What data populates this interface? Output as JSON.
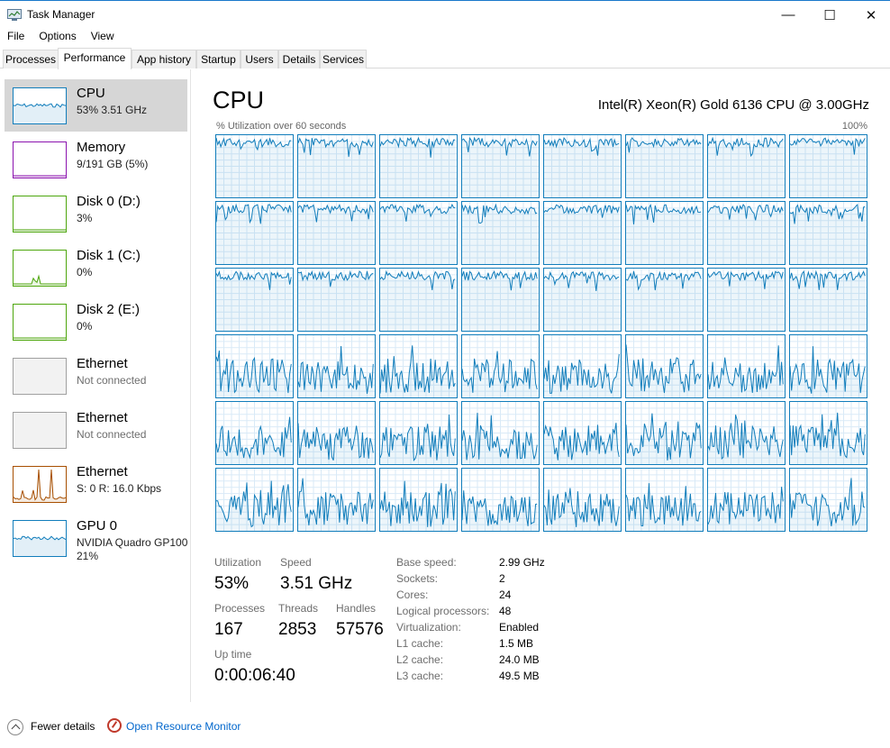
{
  "window": {
    "title": "Task Manager",
    "minimize": "—",
    "maximize": "☐",
    "close": "✕"
  },
  "menu": [
    "File",
    "Options",
    "View"
  ],
  "tabs": [
    "Processes",
    "Performance",
    "App history",
    "Startup",
    "Users",
    "Details",
    "Services"
  ],
  "active_tab": "Performance",
  "sidebar": [
    {
      "name": "CPU",
      "sub": "53%  3.51 GHz",
      "color": "#117dbb",
      "selected": true,
      "kind": "cpu"
    },
    {
      "name": "Memory",
      "sub": "9/191 GB (5%)",
      "color": "#8b12ae",
      "kind": "flat"
    },
    {
      "name": "Disk 0 (D:)",
      "sub": "3%",
      "color": "#4da60c",
      "kind": "flat"
    },
    {
      "name": "Disk 1 (C:)",
      "sub": "0%",
      "color": "#4da60c",
      "kind": "disk"
    },
    {
      "name": "Disk 2 (E:)",
      "sub": "0%",
      "color": "#4da60c",
      "kind": "flat"
    },
    {
      "name": "Ethernet",
      "sub": "Not connected",
      "color": "#a0a0a0",
      "kind": "empty",
      "muted": true
    },
    {
      "name": "Ethernet",
      "sub": "Not connected",
      "color": "#a0a0a0",
      "kind": "empty",
      "muted": true
    },
    {
      "name": "Ethernet",
      "sub": "S: 0  R: 16.0 Kbps",
      "color": "#a74f01",
      "kind": "net"
    },
    {
      "name": "GPU 0",
      "sub": "NVIDIA Quadro GP100",
      "sub2": "21%",
      "color": "#117dbb",
      "kind": "cpu"
    }
  ],
  "main": {
    "title": "CPU",
    "cpu_model": "Intel(R) Xeon(R) Gold 6136 CPU @ 3.00GHz",
    "graph_label": "% Utilization over 60 seconds",
    "graph_max": "100%",
    "graph_color": "#117dbb",
    "grid_rows": 6,
    "grid_cols": 8
  },
  "stats": {
    "utilization_label": "Utilization",
    "utilization": "53%",
    "speed_label": "Speed",
    "speed": "3.51 GHz",
    "processes_label": "Processes",
    "processes": "167",
    "threads_label": "Threads",
    "threads": "2853",
    "handles_label": "Handles",
    "handles": "57576",
    "uptime_label": "Up time",
    "uptime": "0:00:06:40"
  },
  "specs": [
    {
      "label": "Base speed:",
      "value": "2.99 GHz"
    },
    {
      "label": "Sockets:",
      "value": "2"
    },
    {
      "label": "Cores:",
      "value": "24"
    },
    {
      "label": "Logical processors:",
      "value": "48"
    },
    {
      "label": "Virtualization:",
      "value": "Enabled"
    },
    {
      "label": "L1 cache:",
      "value": "1.5 MB"
    },
    {
      "label": "L2 cache:",
      "value": "24.0 MB"
    },
    {
      "label": "L3 cache:",
      "value": "49.5 MB"
    }
  ],
  "footer": {
    "fewer_details": "Fewer details",
    "resource_monitor": "Open Resource Monitor"
  }
}
